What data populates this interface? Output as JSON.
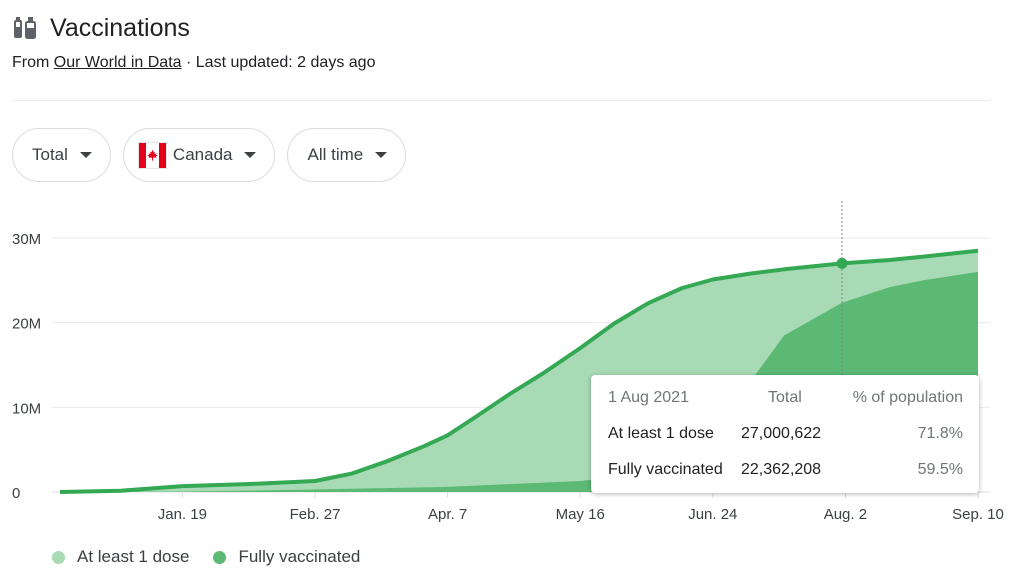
{
  "header": {
    "title": "Vaccinations",
    "source_prefix": "From",
    "source_name": "Our World in Data",
    "separator": "·",
    "updated": "Last updated: 2 days ago"
  },
  "filters": [
    {
      "label": "Total"
    },
    {
      "label": "Canada",
      "flag": "canada-flag"
    },
    {
      "label": "All time"
    }
  ],
  "colors": {
    "at_least_one": "#a8dab5",
    "fully": "#5bb974",
    "line": "#34a853",
    "grid": "#e8eaed"
  },
  "tooltip": {
    "date": "1 Aug 2021",
    "col_total": "Total",
    "col_pct": "% of population",
    "rows": [
      {
        "label": "At least 1 dose",
        "total": "27,000,622",
        "pct": "71.8%"
      },
      {
        "label": "Fully vaccinated",
        "total": "22,362,208",
        "pct": "59.5%"
      }
    ]
  },
  "legend": [
    {
      "label": "At least 1 dose",
      "color": "#a8dab5"
    },
    {
      "label": "Fully vaccinated",
      "color": "#5bb974"
    }
  ],
  "chart_data": {
    "type": "area",
    "x_tick_labels": [
      "Jan. 19",
      "Feb. 27",
      "Apr. 7",
      "May 16",
      "Jun. 24",
      "Aug. 2",
      "Sep. 10"
    ],
    "y_tick_labels": [
      "0",
      "10M",
      "20M",
      "30M"
    ],
    "ylim": [
      0,
      30000000
    ],
    "xlim": [
      "2020-12-14",
      "2021-09-10"
    ],
    "grid": true,
    "legend_position": "bottom-left",
    "highlight": {
      "x": "2021-08-01",
      "y": 27000622
    },
    "series": [
      {
        "name": "At least 1 dose",
        "points": [
          [
            "2020-12-14",
            0
          ],
          [
            "2021-01-01",
            150000
          ],
          [
            "2021-01-19",
            700000
          ],
          [
            "2021-02-08",
            950000
          ],
          [
            "2021-02-27",
            1300000
          ],
          [
            "2021-03-10",
            2200000
          ],
          [
            "2021-03-20",
            3600000
          ],
          [
            "2021-03-31",
            5400000
          ],
          [
            "2021-04-07",
            6700000
          ],
          [
            "2021-04-15",
            8800000
          ],
          [
            "2021-04-25",
            11500000
          ],
          [
            "2021-05-05",
            14000000
          ],
          [
            "2021-05-16",
            17000000
          ],
          [
            "2021-05-26",
            19900000
          ],
          [
            "2021-06-05",
            22300000
          ],
          [
            "2021-06-15",
            24100000
          ],
          [
            "2021-06-24",
            25100000
          ],
          [
            "2021-07-05",
            25800000
          ],
          [
            "2021-07-15",
            26300000
          ],
          [
            "2021-08-01",
            27000622
          ],
          [
            "2021-08-15",
            27400000
          ],
          [
            "2021-08-25",
            27800000
          ],
          [
            "2021-09-10",
            28500000
          ]
        ]
      },
      {
        "name": "Fully vaccinated",
        "points": [
          [
            "2020-12-14",
            0
          ],
          [
            "2021-01-19",
            50000
          ],
          [
            "2021-02-27",
            300000
          ],
          [
            "2021-04-07",
            600000
          ],
          [
            "2021-05-16",
            1300000
          ],
          [
            "2021-06-05",
            2200000
          ],
          [
            "2021-06-15",
            4500000
          ],
          [
            "2021-06-24",
            8000000
          ],
          [
            "2021-07-05",
            13000000
          ],
          [
            "2021-07-15",
            18500000
          ],
          [
            "2021-08-01",
            22362208
          ],
          [
            "2021-08-15",
            24200000
          ],
          [
            "2021-08-25",
            25000000
          ],
          [
            "2021-09-10",
            26000000
          ]
        ]
      }
    ]
  }
}
